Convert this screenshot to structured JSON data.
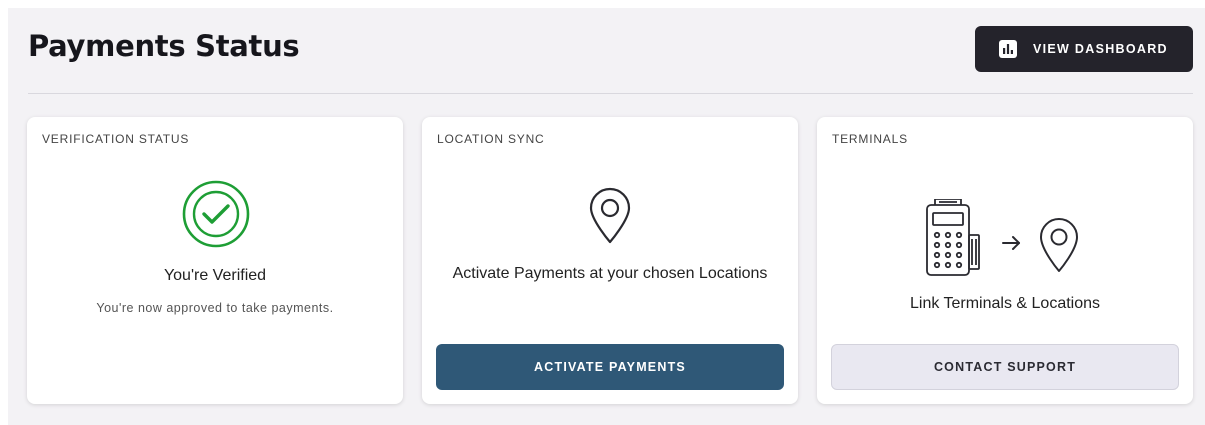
{
  "header": {
    "title": "Payments Status",
    "dashboard_button": {
      "label": "VIEW DASHBOARD",
      "icon": "bar-chart-icon"
    }
  },
  "cards": {
    "verification": {
      "title": "VERIFICATION STATUS",
      "icon": "check-circle-icon",
      "heading": "You're Verified",
      "subtext": "You're now approved to take payments."
    },
    "location_sync": {
      "title": "LOCATION SYNC",
      "icon": "map-pin-icon",
      "heading": "Activate Payments at your chosen Locations",
      "button_label": "ACTIVATE PAYMENTS"
    },
    "terminals": {
      "title": "TERMINALS",
      "icons": [
        "payment-terminal-icon",
        "arrow-right-icon",
        "map-pin-icon"
      ],
      "heading": "Link Terminals & Locations",
      "button_label": "CONTACT SUPPORT"
    }
  },
  "colors": {
    "page_background": "#f3f2f5",
    "dark_button": "#24232b",
    "primary_button": "#2f5877",
    "secondary_button": "#e9e8f1",
    "success_green": "#1e9e35"
  }
}
